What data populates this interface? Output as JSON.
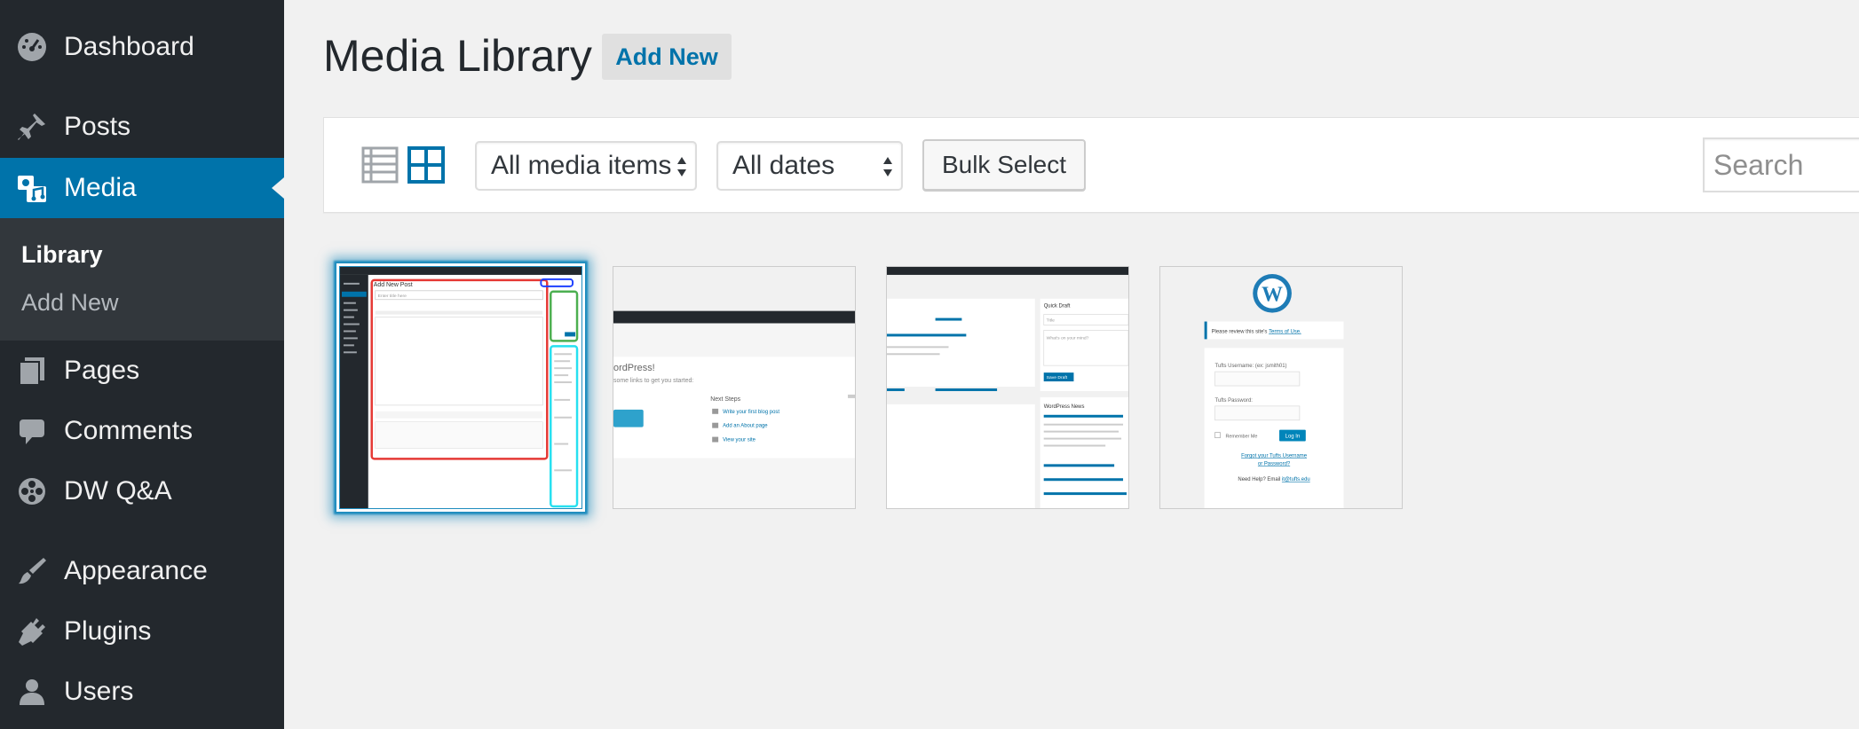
{
  "sidebar": {
    "items": [
      {
        "label": "Dashboard",
        "icon": "dashboard-icon"
      },
      {
        "label": "Posts",
        "icon": "pin-icon"
      },
      {
        "label": "Media",
        "icon": "media-icon",
        "active": true
      },
      {
        "label": "Pages",
        "icon": "pages-icon"
      },
      {
        "label": "Comments",
        "icon": "comment-icon"
      },
      {
        "label": "DW Q&A",
        "icon": "film-reel-icon"
      },
      {
        "label": "Appearance",
        "icon": "paintbrush-icon"
      },
      {
        "label": "Plugins",
        "icon": "plug-icon"
      },
      {
        "label": "Users",
        "icon": "user-icon"
      }
    ],
    "submenu": [
      {
        "label": "Library",
        "current": true
      },
      {
        "label": "Add New"
      }
    ]
  },
  "header": {
    "title": "Media Library",
    "add_new_label": "Add New"
  },
  "toolbar": {
    "view_modes": [
      "list-view-icon",
      "grid-view-icon"
    ],
    "active_view": "grid",
    "type_filter": "All media items",
    "date_filter": "All dates",
    "bulk_select_label": "Bulk Select",
    "search_placeholder": "Search"
  },
  "attachments": [
    {
      "description": "Add New Post screenshot",
      "selected": true
    },
    {
      "description": "WordPress welcome screenshot",
      "selected": false
    },
    {
      "description": "Dashboard screenshot",
      "selected": false
    },
    {
      "description": "Login screen screenshot",
      "selected": false
    }
  ],
  "thumbnails": {
    "post_editor": {
      "heading": "Add New Post",
      "title_placeholder": "Enter title here"
    },
    "welcome": {
      "heading": "ordPress!",
      "subtext": "some links to get you started:",
      "next_steps": "Next Steps",
      "links": [
        "Write your first blog post",
        "Add an About page",
        "View your site"
      ]
    },
    "dashboard": {
      "quick_draft": "Quick Draft",
      "title_placeholder": "Title",
      "content_placeholder": "What's on your mind?",
      "save_draft": "Save Draft",
      "wordpress_news": "WordPress News"
    },
    "login": {
      "notice_prefix": "Please review this site's",
      "terms_link": "Terms of Use.",
      "username_label": "Tufts Username: (ex: jsmith01)",
      "password_label": "Tufts Password:",
      "remember_me": "Remember Me",
      "login_button": "Log In",
      "forgot_line1": "Forgot your Tufts Username",
      "forgot_line2": "or Password?",
      "help_prefix": "Need Help? Email",
      "help_email": "it@tufts.edu"
    }
  },
  "colors": {
    "sidebar_bg": "#23282d",
    "submenu_bg": "#32373c",
    "accent": "#0073aa",
    "page_bg": "#f1f1f1"
  }
}
